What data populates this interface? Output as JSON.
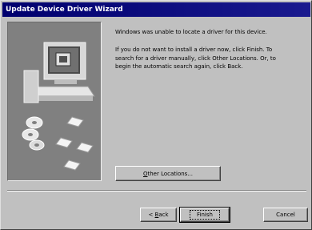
{
  "window": {
    "title": "Update Device Driver Wizard"
  },
  "message": {
    "line1": "Windows was unable to locate a driver for this device.",
    "line2": "If you do not want to install a driver now, click Finish. To",
    "line3": "search for a driver manually, click Other Locations. Or, to",
    "line4": "begin the automatic search again, click Back."
  },
  "other_locations": {
    "mnemonic": "O",
    "rest": "ther Locations..."
  },
  "buttons": {
    "back_mnemonic": "B",
    "back_rest": "ack",
    "back_prefix": "< ",
    "finish": "Finish",
    "cancel": "Cancel"
  }
}
